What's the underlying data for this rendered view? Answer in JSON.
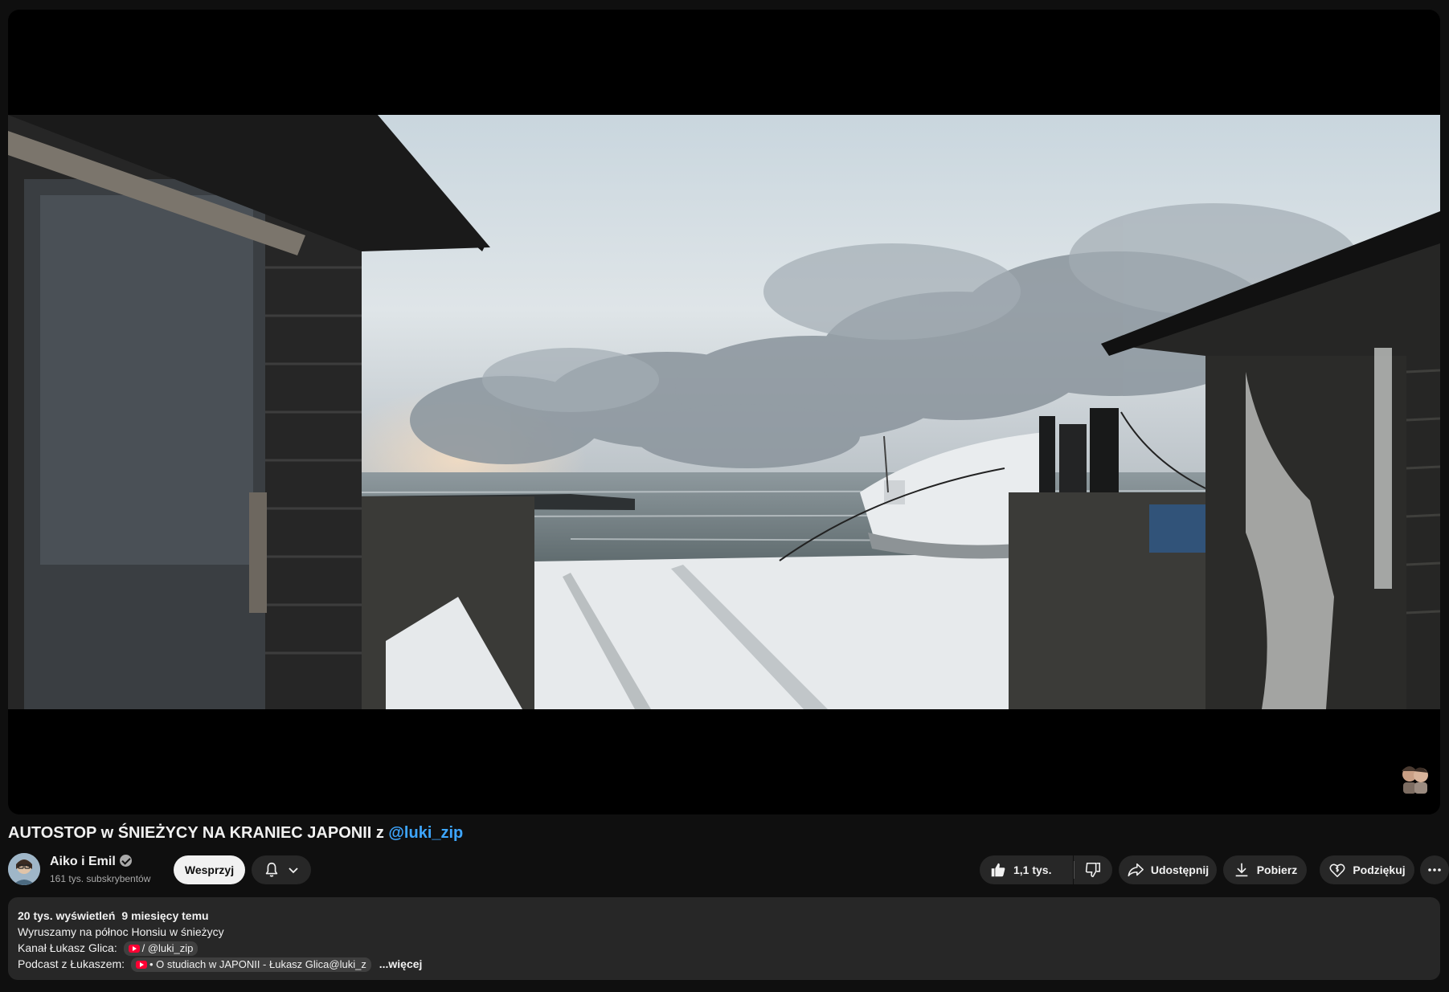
{
  "video": {
    "title": "AUTOSTOP w ŚNIEŻYCY NA KRANIEC JAPONII z ",
    "title_mention": "@luki_zip"
  },
  "channel": {
    "name": "Aiko i Emil",
    "subscribers": "161 tys. subskrybentów",
    "support_label": "Wesprzyj"
  },
  "actions": {
    "like_count": "1,1 tys.",
    "share_label": "Udostępnij",
    "download_label": "Pobierz",
    "thanks_label": "Podziękuj"
  },
  "description": {
    "views": "20 tys. wyświetleń",
    "date": "9 miesięcy temu",
    "line1": "Wyruszamy na północ Honsiu w śnieżycy",
    "line2_prefix": "Kanał Łukasz Glica:",
    "line2_chip": "/ @luki_zip",
    "line3_prefix": "Podcast z Łukaszem:",
    "line3_chip": "• O studiach w JAPONII - Łukasz Glica@luki_z",
    "more_label": "...więcej"
  },
  "icons": {
    "verified": "verified-badge-icon",
    "bell": "bell-icon",
    "chevron": "chevron-down-icon",
    "like": "thumbs-up-icon",
    "dislike": "thumbs-down-icon",
    "share": "share-arrow-icon",
    "download": "download-icon",
    "thanks": "heart-dollar-icon",
    "more": "more-horizontal-icon"
  },
  "colors": {
    "background": "#0f0f0f",
    "button": "#272727",
    "mention": "#3ea6ff",
    "support_button": "#f1f1f1"
  }
}
